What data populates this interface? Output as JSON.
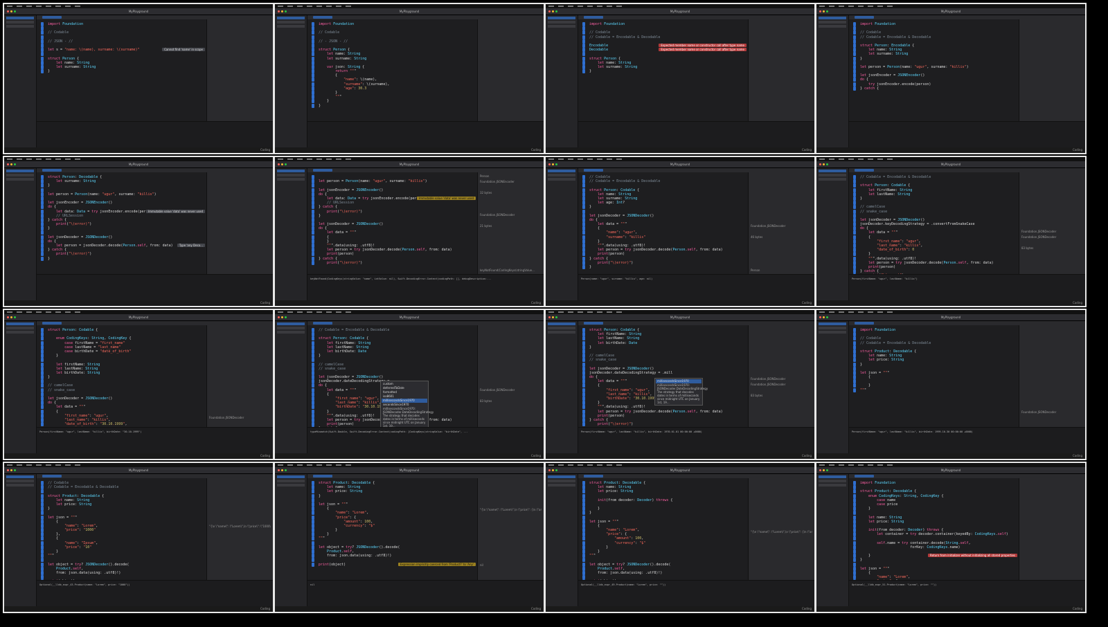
{
  "footer_label": "Coding",
  "window_title": "MyPlayground",
  "frames": [
    {
      "code": [
        "import Foundation",
        "",
        "// Codable",
        "",
        "// JSON - //",
        "",
        "let s = \"name: \\(name), surname: \\(surname)\"",
        "",
        "struct Person {",
        "    let name: String",
        "    let surname: String",
        "}"
      ],
      "issues": [
        {
          "kind": "info",
          "text": "Cannot find 'name' in scope",
          "line": 6
        }
      ],
      "results": [],
      "console": ""
    },
    {
      "code": [
        "import Foundation",
        "",
        "// Codable",
        "",
        "// - JSON - //",
        "",
        "struct Person {",
        "    let name: String",
        "    let surname: String",
        "",
        "    var json: String {",
        "        return \"\"\"",
        "        {",
        "            \"name\": \\(name),",
        "            \"surname\": \\(surname),",
        "            \"age\": 30.3",
        "        }",
        "        \"\"\"",
        "    }",
        "}"
      ],
      "issues": [],
      "results": [],
      "console": ""
    },
    {
      "code": [
        "import Foundation",
        "",
        "// Codable",
        "// Codable = Encodable & Decodable",
        "",
        "Encodable",
        "Decodable",
        "",
        "struct Person {",
        "    let name: String",
        "    let surname: String",
        "}"
      ],
      "issues": [
        {
          "kind": "err",
          "text": "Expected member name or constructor call after type name",
          "line": 5
        },
        {
          "kind": "err",
          "text": "Expected member name or constructor call after type name",
          "line": 6
        }
      ],
      "results": [],
      "console": ""
    },
    {
      "code": [
        "import Foundation",
        "",
        "// Codable",
        "// Codable = Encodable & Decodable",
        "",
        "struct Person: Encodable {",
        "    let name: String",
        "    let surname: String",
        "}",
        "",
        "let person = Person(name: \"ugur\", surname: \"killis\")",
        "",
        "let jsonEncoder = JSONEncoder()",
        "do {",
        "    try jsonEncoder.encode(person)",
        "} catch {"
      ],
      "issues": [],
      "results": [],
      "console": ""
    },
    {
      "code": [
        "struct Person: Decodable {",
        "    let surname: String",
        "}",
        "",
        "let person = Person(name: \"ugur\", surname: \"killis\")",
        "",
        "let jsonEncoder = JSONEncoder()",
        "do {",
        "    let data: Data = try jsonEncoder.encode(person)",
        "    // URLSession",
        "} catch {",
        "    print(\"\\(error)\")",
        "}",
        "",
        "let jsonDecoder = JSONDecoder()",
        "do {",
        "    let person = jsonDecoder.decode(Person.self, from: data)",
        "} catch {",
        "    print(\"\\(error)\")",
        "}"
      ],
      "issues": [
        {
          "kind": "info",
          "text": "Immutable value 'data' was never used",
          "line": 8
        },
        {
          "kind": "info",
          "text": "Type 'any Deco...",
          "line": 16
        }
      ],
      "results": [],
      "console": ""
    },
    {
      "code": [
        "",
        "let person = Person(name: \"ugur\", surname: \"killis\")",
        "",
        "let jsonEncoder = JSONEncoder()",
        "do {",
        "    let data: Data = try jsonEncoder.encode(person)",
        "    // URLSession",
        "} catch {",
        "    print(\"\\(error)\")",
        "}",
        "",
        "let jsonDecoder = JSONDecoder()",
        "do {",
        "    let data = \"\"\"",
        "    {",
        "    }",
        "    \"\"\".data(using: .utf8)!",
        "    let person = try jsonDecoder.decode(Person.self, from: data)",
        "    print(person)",
        "} catch {",
        "    print(\"\\(error)\")"
      ],
      "issues": [
        {
          "kind": "warn",
          "text": "Immutable value 'data' was never used",
          "line": 5
        }
      ],
      "results": [
        "Person",
        "Foundation.JSONEncoder",
        "",
        "32 bytes",
        "",
        "",
        "",
        "Foundation.JSONDecoder",
        "",
        "21 bytes",
        "",
        "",
        "",
        "",
        "",
        "",
        "",
        "keyNotFound(CodingKeys(stringValue..."
      ],
      "console": "keyNotFound(CodingKeys(stringValue: \"name\", intValue: nil), Swift.DecodingError.Context(codingPath: [], debugDescription:..."
    },
    {
      "code": [
        "// Codable",
        "// Codable = Encodable & Decodable",
        "",
        "struct Person: Codable {",
        "    let name: String",
        "    let surname: String",
        "    let age: Int?",
        "}",
        "",
        "let jsonDecoder = JSONDecoder()",
        "do {",
        "    let data = \"\"\"",
        "    {",
        "        \"name\": \"ugur\",",
        "        \"surname\": \"killis\"",
        "    }",
        "    \"\"\".data(using: .utf8)!",
        "    let person = try jsonDecoder.decode(Person.self, from: data)",
        "    print(person)",
        "} catch {",
        "    print(\"\\(error)\")",
        "}"
      ],
      "issues": [],
      "results": [
        "",
        "",
        "",
        "",
        "",
        "",
        "",
        "",
        "",
        "Foundation.JSONDecoder",
        "",
        "46 bytes",
        "",
        "",
        "",
        "",
        "",
        "Person",
        "\"Person(name: \\\"ugur\\\", surname: \\\"killis\\\", age: nil)\\n\""
      ],
      "console": "Person(name: \"ugur\", surname: \"killis\", age: nil)"
    },
    {
      "code": [
        "// Codable = Encodable & Decodable",
        "",
        "struct Person: Codable {",
        "    let firstName: String",
        "    let lastName: String",
        "}",
        "",
        "// camelCase",
        "// snake_case",
        "",
        "let jsonDecoder = JSONDecoder()",
        "jsonDecoder.keyDecodingStrategy = .convertFromSnakeCase",
        "do {",
        "    let data = \"\"\"",
        "    {",
        "        \"first_name\": \"ugur\",",
        "        \"last_name\": \"killis\",",
        "        \"date_of_birth\": 0",
        "    }",
        "    \"\"\".data(using: .utf8)!",
        "    let person = try jsonDecoder.decode(Person.self, from: data)",
        "    print(person)",
        "} catch {",
        "    print(\"\\(error)\")"
      ],
      "issues": [],
      "results": [
        "",
        "",
        "",
        "",
        "",
        "",
        "",
        "",
        "",
        "",
        "Foundation.JSONDecoder",
        "Foundation.JSONDecoder",
        "",
        "83 bytes",
        "",
        "",
        "",
        "",
        "",
        "",
        "Person",
        "\"Person(firstName: \\\"ugur\\\", lastName: \\\"killis\\\")\\n\""
      ],
      "console": "Person(firstName: \"ugur\", lastName: \"killis\")"
    },
    {
      "code": [
        "struct Person: Codable {",
        "",
        "    enum CodingKeys: String, CodingKey {",
        "        case firstName = \"first_name\"",
        "        case lastName = \"last_name\"",
        "        case birthDate = \"date_of_birth\"",
        "    }",
        "",
        "    let firstName: String",
        "    let lastName: String",
        "    let birthDate: String",
        "}",
        "",
        "// camelCase",
        "// snake_case",
        "",
        "let jsonDecoder = JSONDecoder()",
        "do {",
        "    let data = \"\"\"",
        "    {",
        "        \"first_name\": \"ugur\",",
        "        \"last_name\": \"killis\",",
        "        \"date_of_birth\": \"30.10.1999\","
      ],
      "issues": [],
      "results": [
        "",
        "",
        "",
        "",
        "",
        "",
        "",
        "",
        "",
        "",
        "",
        "",
        "",
        "",
        "",
        "",
        "Foundation.JSONDecoder",
        "",
        "83 bytes"
      ],
      "console": "Person(firstName: \"ugur\", lastName: \"killis\", birthDate: \"30.10.1999\")"
    },
    {
      "code": [
        "// Codable = Encodable & Decodable",
        "",
        "struct Person: Codable {",
        "    let firstName: String",
        "    let lastName: String",
        "    let birthDate: Date",
        "}",
        "",
        "// camelCase",
        "// snake_case",
        "",
        "let jsonDecoder = JSONDecoder()",
        "jsonDecoder.dateDecodingStrategy = .",
        "do {",
        "    let data = \"\"\"",
        "    {",
        "        \"first_name\": \"ugur\",",
        "        \"last_name\": \"killis\",",
        "        \"birthDate\": \"30.10.1999\"",
        "    }",
        "    \"\"\".data(using: .utf8)!",
        "    let person = try jsonDecoder.decode(Person.self, from: data)",
        "    print(person)",
        "} catch {"
      ],
      "issues": [],
      "results": [
        "",
        "",
        "",
        "",
        "",
        "",
        "",
        "",
        "",
        "",
        "",
        "Foundation.JSONDecoder",
        "",
        "83 bytes"
      ],
      "popup": {
        "items": [
          "custom",
          "deferredToDate",
          "formatted",
          "iso8601",
          "millisecondsSince1970",
          "secondsSince1970"
        ],
        "selected": 4,
        "note": "millisecondsSince1970: JSONDecoder.DateDecodingStrategy The strategy that decodes dates in terms of milliseconds since midnight UTC on January 1st, 19..."
      },
      "console": "typeMismatch(Swift.Double, Swift.DecodingError.Context(codingPath: [CodingKeys(stringValue: \"birthDate\", ..."
    },
    {
      "code": [
        "struct Person: Codable {",
        "    let firstName: String",
        "    let lastName: String",
        "    let birthDate: Date",
        "}",
        "",
        "// camelCase",
        "// snake_case",
        "",
        "let jsonDecoder = JSONDecoder()",
        "jsonDecoder.dateDecodingStrategy = .mill",
        "do {",
        "    let data = \"\"\"",
        "    {",
        "        \"first_name\": \"ugur\",",
        "        \"last_name\": \"killis\",",
        "        \"birthDate\": \"30.10.1999\"",
        "    }",
        "    \"\"\".data(using: .utf8)!",
        "    let person = try jsonDecoder.decode(Person.self, from: data)",
        "    print(person)",
        "} catch {",
        "    print(\"\\(error)\")"
      ],
      "issues": [],
      "results": [
        "",
        "",
        "",
        "",
        "",
        "",
        "",
        "",
        "",
        "Foundation.JSONDecoder",
        "Foundation.JSONDecoder",
        "",
        "83 bytes",
        "",
        "",
        "",
        "",
        "",
        "",
        "Person",
        "\"Person(firstName: \\\"ugur\\\", lastName: \\\"kil..."
      ],
      "popup": {
        "items": [
          "millisecondsSince1970"
        ],
        "selected": 0,
        "note": "millisecondsSince1970: JSONDecoder.DateDecodingStrategy The strategy that decodes dates in terms of milliseconds since midnight UTC on January 1st, 19..."
      },
      "console": "Person(firstName: \"ugur\", lastName: \"killis\", birthDate: 1970-01-01 00:00:00 +0000)"
    },
    {
      "code": [
        "import Foundation",
        "",
        "// Codable",
        "// Codable = Encodable & Decodable",
        "",
        "struct Product: Decodable {",
        "    let name: String",
        "    let price: String",
        "}",
        "",
        "let json = \"\"\"",
        "    {",
        "",
        "    }",
        "\"\"\""
      ],
      "issues": [],
      "results": [
        "",
        "",
        "",
        "",
        "",
        "",
        "",
        "",
        "",
        "",
        "",
        "",
        "",
        "",
        "",
        "Foundation.JSONDecoder"
      ],
      "console": "Person(firstName: \"ugur\", lastName: \"killis\", birthDate: 1999-10-30 00:00:00 +0000)"
    },
    {
      "code": [
        "// Codable",
        "// Codable = Encodable & Decodable",
        "",
        "struct Product: Decodable {",
        "    let name: String",
        "    let price: String",
        "}",
        "",
        "let json = \"\"\"",
        "    {",
        "        \"name\": \"Lorem\",",
        "        \"price\": \"1000\"",
        "    },",
        "    {",
        "        \"name\": \"Ipsum\",",
        "        \"price\": \"10\"",
        "    }",
        "\"\"\"",
        "",
        "let object = try? JSONDecoder().decode(",
        "    Product.self,",
        "    from: json.data(using: .utf8)!)",
        "",
        "print(object)"
      ],
      "issues": [
        {
          "kind": "info",
          "text": "Expression implicitly coerced from 'Product?' to 'Any'",
          "line": 23
        }
      ],
      "results": [
        "",
        "",
        "",
        "",
        "",
        "",
        "",
        "",
        "\"{\\n  \\\"name\\\": \\\"Lorem\\\",\\n  \\\"price\\\": \\\"1000\\\"\\n},...",
        "",
        "",
        "",
        "",
        "",
        "",
        "",
        "",
        "",
        "",
        "Product",
        "",
        "",
        "",
        "Optional(__lldb_expr_43.Product(name: \\\"Lor..."
      ],
      "console": "Optional(__lldb_expr_43.Product(name: \"Lorem\", price: \"1000\"))"
    },
    {
      "code": [
        "struct Product: Decodable {",
        "    let name: String",
        "    let price: String",
        "}",
        "",
        "let json = \"\"\"",
        "    {",
        "        \"name\": \"Lorem\",",
        "        \"price\": {",
        "            \"amount\": 100,",
        "            \"currency\": \"$\"",
        "        }",
        "    }",
        "\"\"\"",
        "",
        "let object = try? JSONDecoder().decode(",
        "    Product.self,",
        "    from: json.data(using: .utf8)!)",
        "",
        "print(object)"
      ],
      "issues": [
        {
          "kind": "warn",
          "text": "Expression implicitly coerced from 'Product?' to 'Any'",
          "line": 19
        }
      ],
      "results": [
        "",
        "",
        "",
        "",
        "",
        "\"{\\n  \\\"name\\\": \\\"Lorem\\\",\\n  \\\"price\\\": {\\n  \\\"am...",
        "",
        "",
        "",
        "",
        "",
        "",
        "",
        "",
        "",
        "nil",
        "",
        "",
        "",
        "nil\\n"
      ],
      "console": "nil"
    },
    {
      "code": [
        "struct Product: Decodable {",
        "    let name: String",
        "    let price: String",
        "",
        "    init(from decoder: Decoder) throws {",
        "",
        "    }",
        "}",
        "",
        "let json = \"\"\"",
        "    {",
        "        \"name\": \"Lorem\",",
        "        \"price\": {",
        "            \"amount\": 100,",
        "            \"currency\": \"$\"",
        "        }",
        "    }",
        "\"\"\"",
        "",
        "let object = try? JSONDecoder().decode(",
        "    Product.self,",
        "    from: json.data(using: .utf8)!)",
        "",
        "print(object)"
      ],
      "issues": [
        {
          "kind": "warn",
          "text": "Expression implicitly coerced from 'Product?' to 'Any'",
          "line": 23
        }
      ],
      "results": [
        "",
        "",
        "",
        "",
        "",
        "",
        "",
        "",
        "",
        "\"{\\n  \\\"name\\\": \\\"Lorem\\\",\\n  \\\"price\\\": {\\n  \\\"am...",
        "",
        "",
        "",
        "",
        "",
        "",
        "",
        "",
        "",
        "Product",
        "",
        "",
        "",
        "Optional(__lldb_expr_49.Product(name: \\\"Lor..."
      ],
      "console": "Optional(__lldb_expr_49.Product(name: \"Lorem\", price: \"\"))"
    },
    {
      "code": [
        "import Foundation",
        "",
        "struct Product: Decodable {",
        "    enum CodingKeys: String, CodingKey {",
        "        case name",
        "        case price",
        "    }",
        "",
        "    let name: String",
        "    let price: String",
        "",
        "    init(from decoder: Decoder) throws {",
        "        let container = try decoder.container(keyedBy: CodingKeys.self)",
        "",
        "        self.name = try container.decode(String.self,",
        "                        forKey: CodingKeys.name)",
        "",
        "    }",
        "}",
        "",
        "let json = \"\"\"",
        "    {",
        "        \"name\": \"Lorem\",",
        "        \"price\": {",
        "            \"amount\": 100,"
      ],
      "issues": [
        {
          "kind": "err",
          "text": "Return from initializer without initializing all stored properties",
          "line": 17
        }
      ],
      "results": [],
      "console": "Optional(__lldb_expr_51.Product(name: \"Lorem\", price: \"\"))"
    }
  ]
}
